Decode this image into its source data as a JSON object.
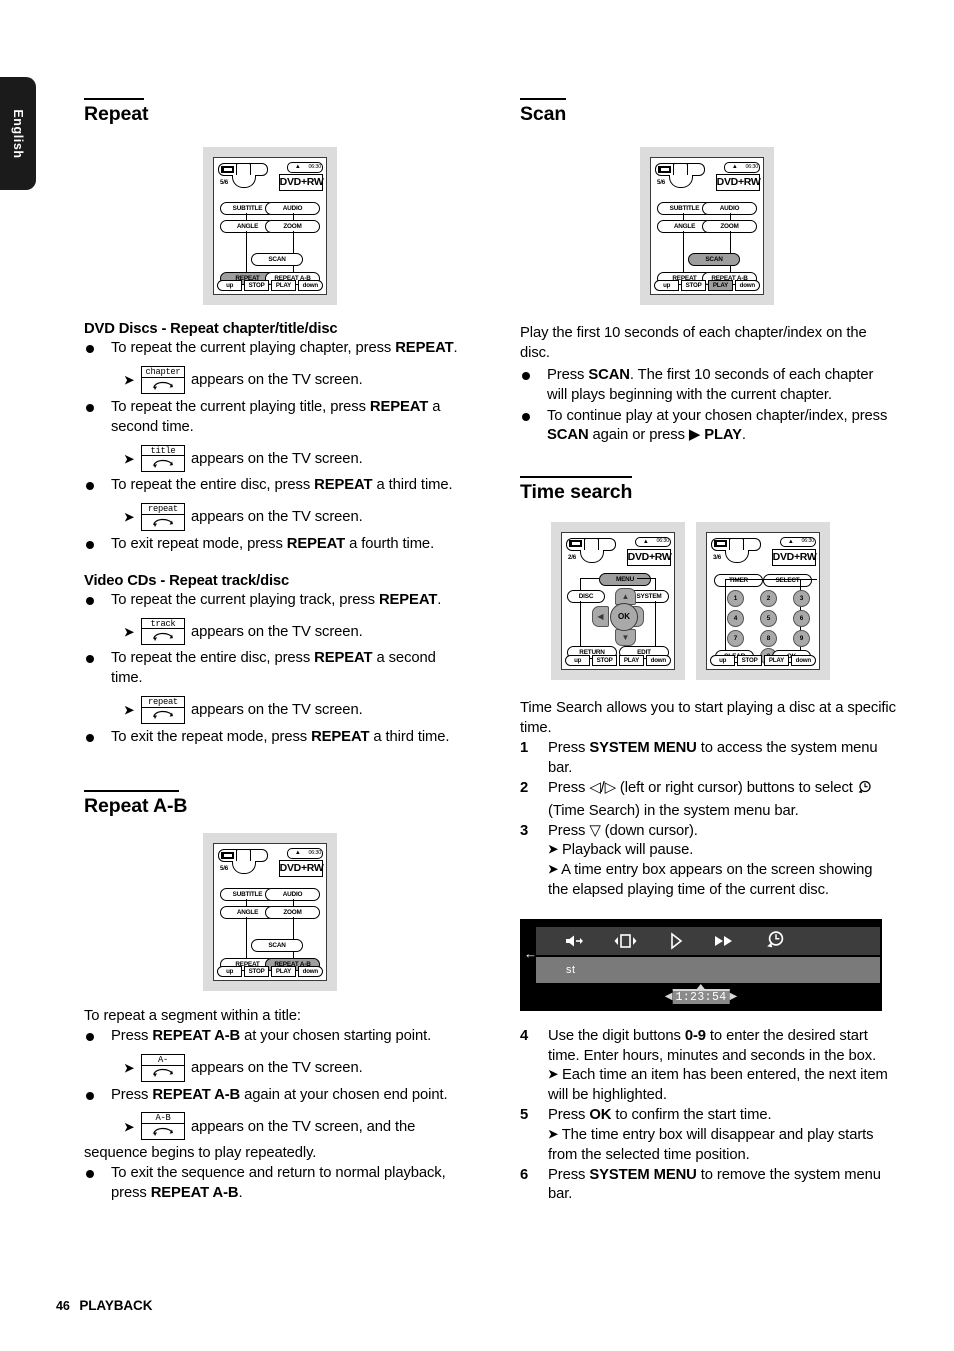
{
  "language_tab": "English",
  "footer": {
    "page_number": "46",
    "section": "PLAYBACK"
  },
  "left_column": {
    "repeat": {
      "heading": "Repeat",
      "figure": {
        "name": "remote-repeat",
        "counter": "5/6",
        "clock": "06:30",
        "disc_label": "DVD+RW",
        "buttons": [
          "SUBTITLE",
          "AUDIO",
          "ANGLE",
          "ZOOM",
          "SCAN",
          "REPEAT",
          "REPEAT A-B"
        ],
        "highlighted": "REPEAT",
        "bottom_bar": [
          "up",
          "STOP",
          "PLAY",
          "down"
        ]
      },
      "dvd": {
        "subheading": "DVD Discs - Repeat chapter/title/disc",
        "items": [
          {
            "bullet": "To repeat the current playing chapter, press ",
            "bold": "REPEAT",
            "tail": "."
          },
          {
            "osd": "chapter",
            "result": "appears on the TV screen."
          },
          {
            "bullet": "To repeat the current playing title, press ",
            "bold": "REPEAT",
            "tail": " a second time."
          },
          {
            "osd": "title",
            "result": "appears on the TV screen."
          },
          {
            "bullet": "To repeat the entire disc, press ",
            "bold": "REPEAT",
            "tail": " a third time."
          },
          {
            "osd": "repeat",
            "result": "appears on the TV screen."
          },
          {
            "bullet": "To exit repeat mode, press ",
            "bold": "REPEAT",
            "tail": " a fourth time."
          }
        ]
      },
      "vcd": {
        "subheading": "Video CDs - Repeat track/disc",
        "items": [
          {
            "bullet": "To repeat the current playing track, press ",
            "bold": "REPEAT",
            "tail": "."
          },
          {
            "osd": "track",
            "result": "appears on the TV screen."
          },
          {
            "bullet": "To repeat the entire disc, press ",
            "bold": "REPEAT",
            "tail": " a second time."
          },
          {
            "osd": "repeat",
            "result": "appears on the TV screen."
          },
          {
            "bullet": "To exit the repeat mode, press ",
            "bold": "REPEAT",
            "tail": " a third time."
          }
        ]
      }
    },
    "repeat_ab": {
      "heading": "Repeat A-B",
      "figure": {
        "name": "remote-repeat-ab",
        "counter": "5/6",
        "clock": "06:30",
        "disc_label": "DVD+RW",
        "buttons": [
          "SUBTITLE",
          "AUDIO",
          "ANGLE",
          "ZOOM",
          "SCAN",
          "REPEAT",
          "REPEAT A-B"
        ],
        "highlighted": "REPEAT A-B",
        "bottom_bar": [
          "up",
          "STOP",
          "PLAY",
          "down"
        ]
      },
      "intro": "To repeat a segment within a title:",
      "items": [
        {
          "bullet": "Press ",
          "bold": "REPEAT A-B",
          "tail": " at your chosen starting point."
        },
        {
          "osd": "A-",
          "result": "appears on the TV screen."
        },
        {
          "bullet": "Press ",
          "bold": "REPEAT A-B",
          "tail": " again at your chosen end point."
        },
        {
          "osd": "A-B",
          "result": "appears on the TV screen, and the",
          "result_cont": "sequence begins to play repeatedly."
        },
        {
          "bullet": "To exit the sequence and return to normal playback, press ",
          "bold": "REPEAT A-B",
          "tail": "."
        }
      ]
    }
  },
  "right_column": {
    "scan": {
      "heading": "Scan",
      "figure": {
        "name": "remote-scan",
        "counter": "5/6",
        "clock": "06:30",
        "disc_label": "DVD+RW",
        "buttons": [
          "SUBTITLE",
          "AUDIO",
          "ANGLE",
          "ZOOM",
          "SCAN",
          "REPEAT",
          "REPEAT A-B"
        ],
        "highlighted": "SCAN",
        "bottom_bar": [
          "up",
          "STOP",
          "PLAY",
          "down"
        ],
        "bottom_highlighted": "PLAY"
      },
      "intro": "Play the first 10 seconds of each chapter/index on the disc.",
      "items": [
        {
          "pre": "Press ",
          "bold": "SCAN",
          "tail": ". The first 10 seconds of each chapter will plays beginning with the current chapter."
        },
        {
          "pre": "To continue play at your chosen chapter/index, press ",
          "bold": "SCAN",
          "mid": " again or press ",
          "bold2": "PLAY",
          "tail2": "."
        }
      ]
    },
    "time_search": {
      "heading": "Time search",
      "figure_left": {
        "name": "remote-cursor-pad",
        "counter": "2/6",
        "clock": "06:30",
        "disc_label": "DVD+RW",
        "buttons": [
          "MENU",
          "DISC",
          "SYSTEM",
          "OK",
          "RETURN",
          "EDIT"
        ],
        "highlighted": "MENU",
        "bottom_bar": [
          "up",
          "STOP",
          "PLAY",
          "down"
        ]
      },
      "figure_right": {
        "name": "remote-numeric-keypad",
        "counter": "3/6",
        "clock": "06:30",
        "disc_label": "DVD+RW",
        "buttons": [
          "TIMER",
          "SELECT",
          "1",
          "2",
          "3",
          "4",
          "5",
          "6",
          "7",
          "8",
          "9",
          "CLEAR",
          "0",
          "OK"
        ],
        "bottom_bar": [
          "up",
          "STOP",
          "PLAY",
          "down"
        ]
      },
      "intro": "Time Search allows you to start playing a disc at a specific time.",
      "steps": [
        {
          "num": "1",
          "pre": "Press ",
          "bold": "SYSTEM MENU",
          "tail": " to access the system menu bar."
        },
        {
          "num": "2",
          "pre": "Press ",
          "cursor": "◁/▷",
          "mid": " (left or right cursor) buttons to select ",
          "icon": "time-search-icon",
          "tail": " (Time Search) in the system menu bar."
        },
        {
          "num": "3",
          "pre": "Press ",
          "cursor": "▽",
          "tail": " (down cursor).",
          "results": [
            "Playback will pause.",
            "A time entry box appears on the screen showing the elapsed playing time of the current disc."
          ]
        },
        {
          "num": "4",
          "pre": "Use the digit buttons ",
          "bold": "0-9",
          "tail": " to enter the desired start time. Enter hours, minutes and seconds in the box.",
          "results": [
            "Each time an item has been entered, the next item will be highlighted."
          ]
        },
        {
          "num": "5",
          "pre": "Press ",
          "bold": "OK",
          "tail": " to confirm the start time.",
          "results": [
            "The time entry box will disappear and play starts from the selected time position."
          ]
        },
        {
          "num": "6",
          "pre": "Press ",
          "bold": "SYSTEM MENU",
          "tail": " to remove the system menu bar."
        }
      ],
      "tv_screenshot": {
        "name": "tv-menu-bar-screenshot",
        "menu_icons": [
          "audio-icon",
          "screen-format-icon",
          "play-icon",
          "fast-forward-icon",
          "time-search-icon"
        ],
        "sub_label": "st",
        "time_value": "1:23:54"
      }
    }
  },
  "colors": {
    "figure_bg": "#dcdcdc",
    "highlight_gray": "#9e9e9e",
    "tv_black": "#000000",
    "tv_menubar": "#3d3d3d",
    "tv_subbar": "#7a7a7a"
  }
}
